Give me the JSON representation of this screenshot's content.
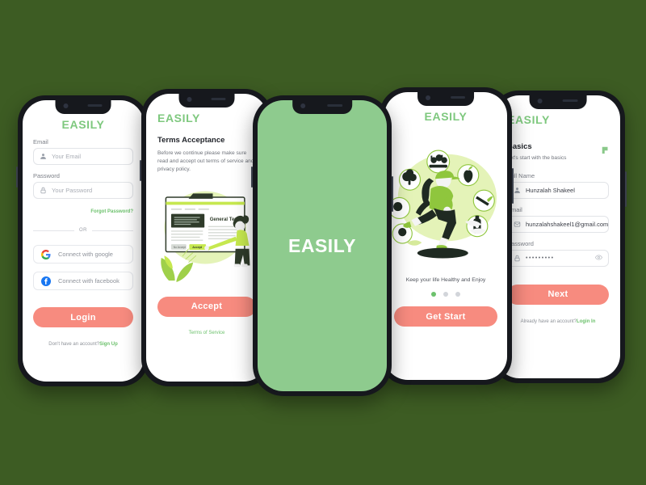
{
  "meta": {
    "background_color": "#3d5c23",
    "accent_green": "#7ec87e",
    "accent_coral": "#f78b7f",
    "splash_green": "#8ecb8e"
  },
  "brand": {
    "name": "EASILY"
  },
  "screens": {
    "login": {
      "logo": "EASILY",
      "email_label": "Email",
      "email_placeholder": "Your Email",
      "email_icon": "person-icon",
      "password_label": "Password",
      "password_placeholder": "Your Password",
      "password_icon": "lock-icon",
      "forgot_link": "Forgot Password?",
      "divider_text": "OR",
      "social": [
        {
          "label": "Connect with google",
          "icon": "google-icon"
        },
        {
          "label": "Connect with facebook",
          "icon": "facebook-icon"
        }
      ],
      "primary_button": "Login",
      "footer_text": "Don't have an account?",
      "footer_link": "Sign Up"
    },
    "terms": {
      "logo": "EASILY",
      "title": "Terms Acceptance",
      "body": "Before we continue please make sure read and accept out terms of service and privacy policy.",
      "illustration": "person-accepting-terms-document-illustration",
      "illustration_doc_title": "General Terms",
      "illustration_accept_label": "Accept",
      "illustration_decline_label": "No Accept",
      "primary_button": "Accept",
      "footer_link": "Terms of Service"
    },
    "splash": {
      "word": "EASILY",
      "background": "#8ecb8e"
    },
    "onboarding": {
      "logo": "EASILY",
      "illustration": "woman-running-with-healthy-food-icons-illustration",
      "caption": "Keep your life Healthy and Enjoy",
      "dots": {
        "total": 3,
        "active_index": 0
      },
      "primary_button": "Get Start"
    },
    "signup": {
      "logo": "EASILY",
      "title": "Basics",
      "subtitle": "Let's start with the basics",
      "corner_icon": "green-flag-icon",
      "name_label": "Full Name",
      "name_value": "Hunzalah Shakeel",
      "name_icon": "person-icon",
      "email_label": "Email",
      "email_value": "hunzalahshakeel1@gmail.com",
      "email_icon": "mail-icon",
      "password_label": "Password",
      "password_value": "•••••••••",
      "password_icon": "lock-icon",
      "password_toggle_icon": "eye-icon",
      "primary_button": "Next",
      "footer_text": "Already have an account?",
      "footer_link": "Login In"
    }
  }
}
